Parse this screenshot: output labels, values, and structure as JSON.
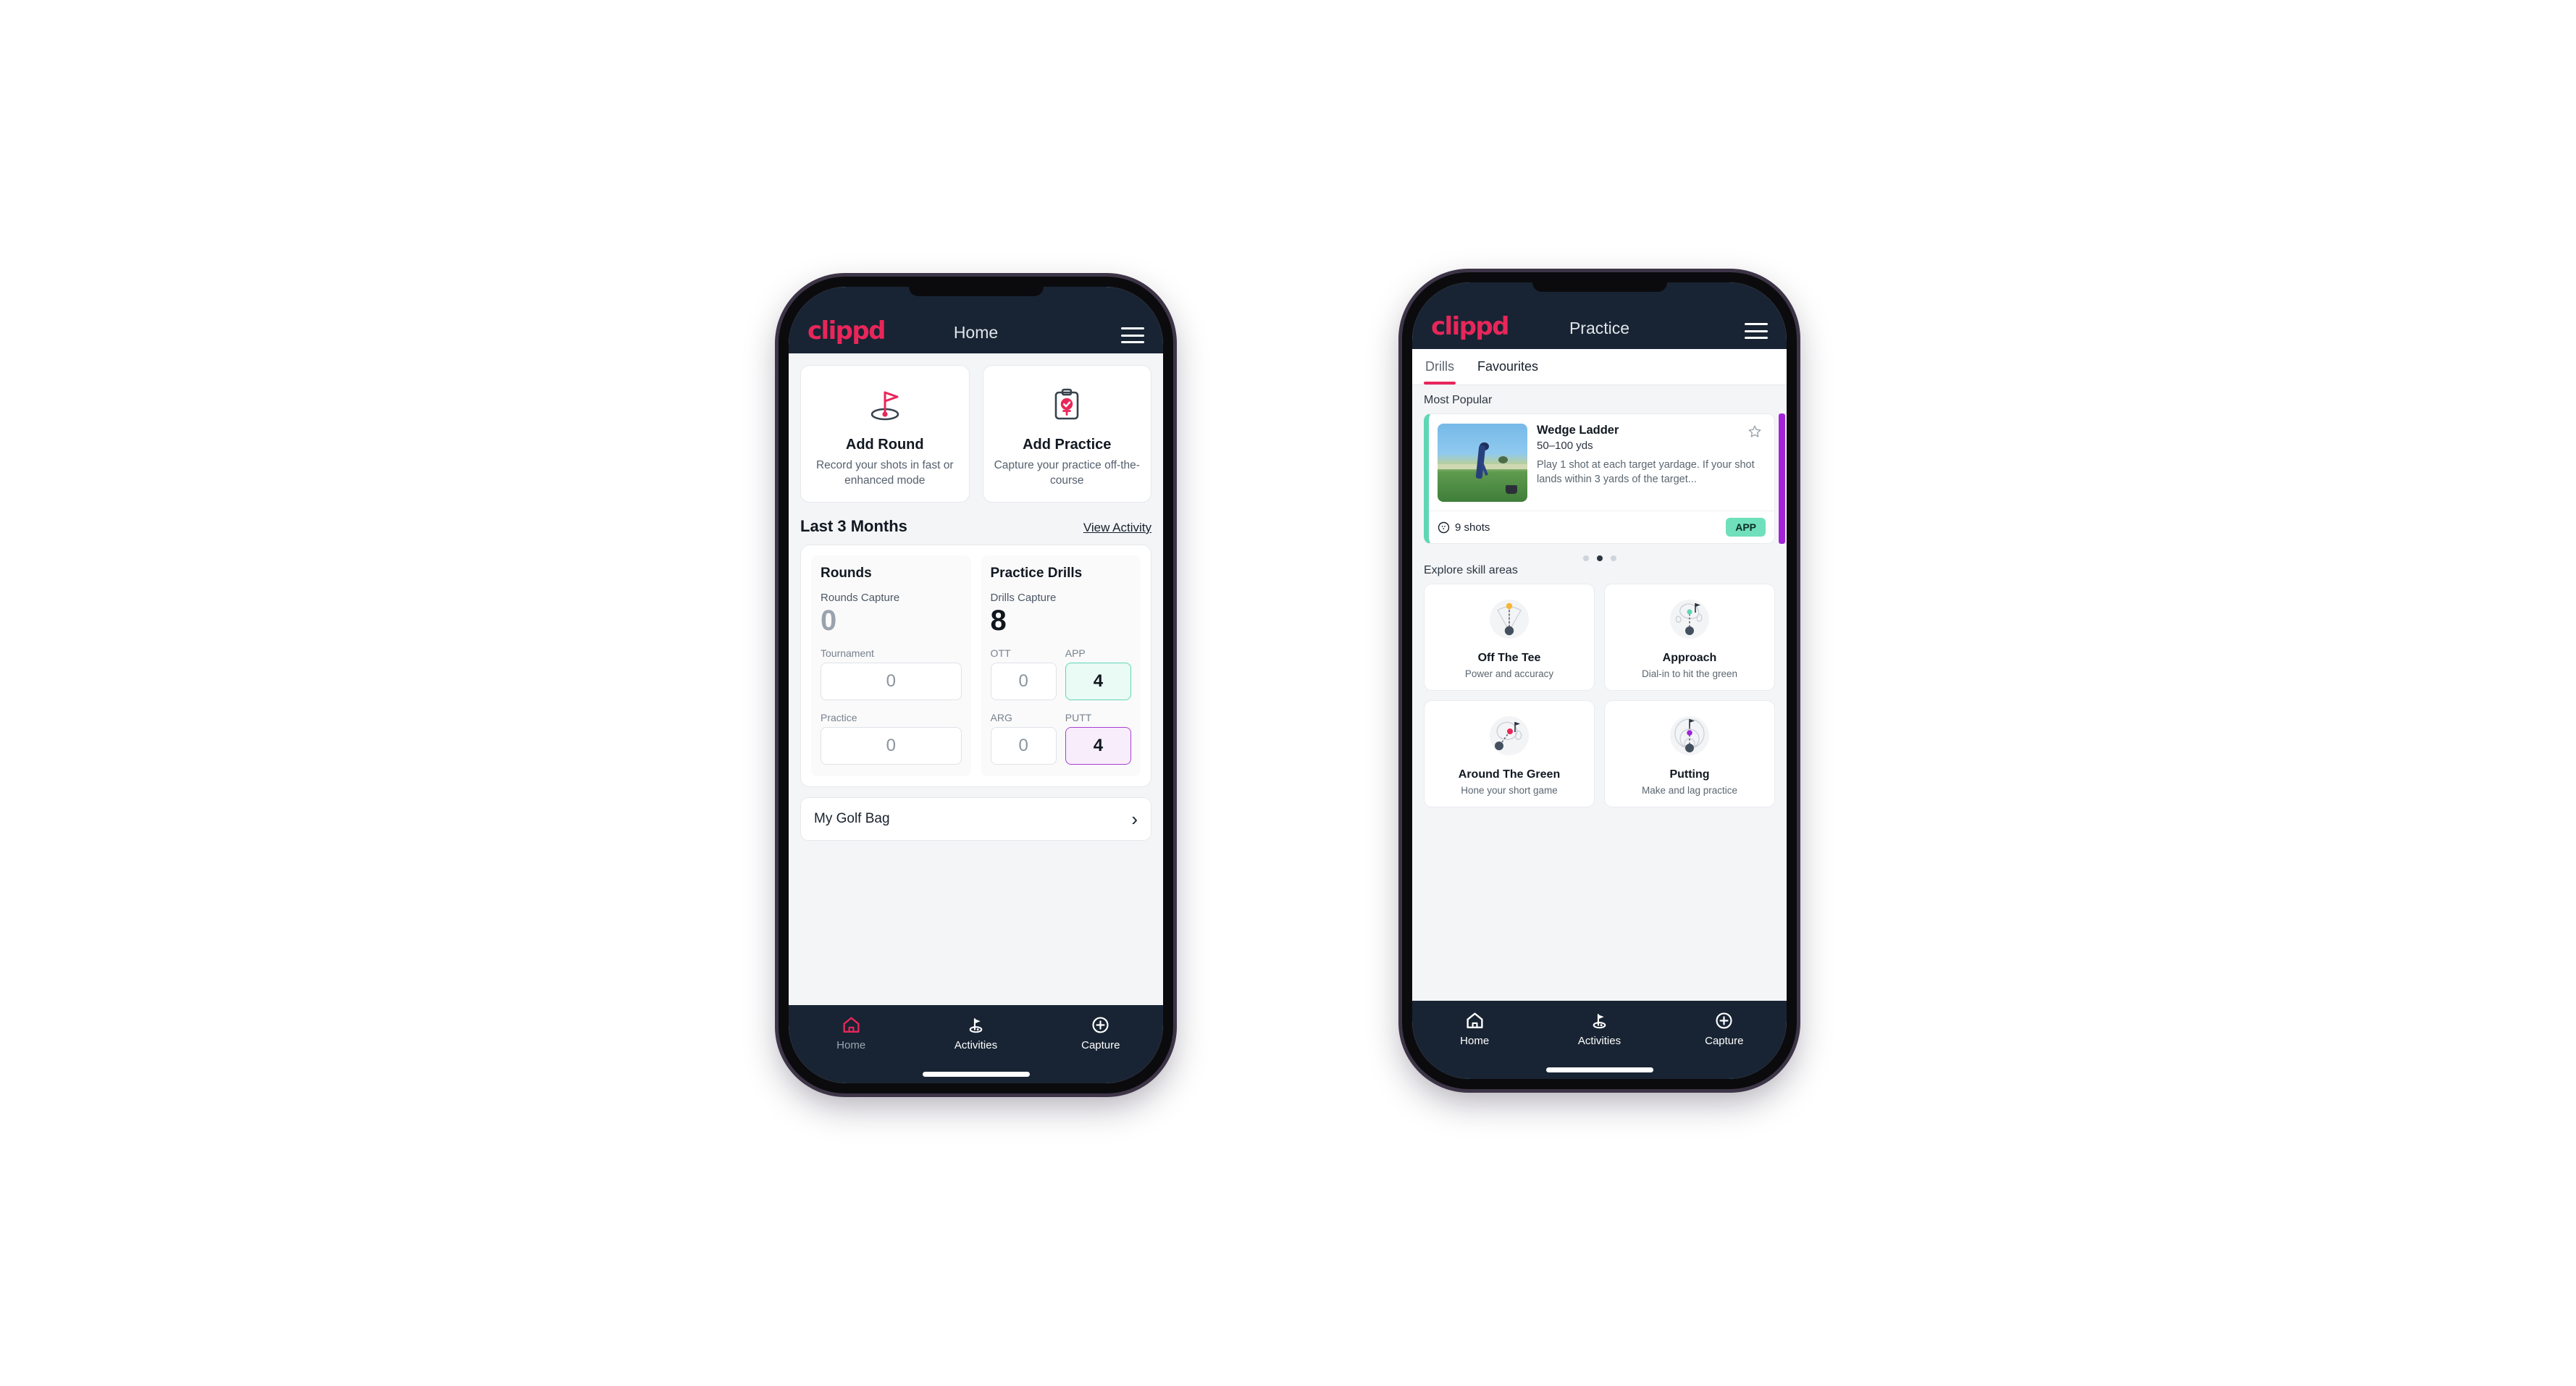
{
  "brand": {
    "logo_text": "clippd",
    "accent_pink": "#e8265a",
    "dark_navy": "#182433",
    "teal": "#6fe0bb",
    "purple": "#a324d8"
  },
  "phone_home": {
    "header": {
      "title": "Home",
      "logo": "clippd",
      "menu_icon": "hamburger-menu-icon"
    },
    "actions": [
      {
        "icon": "golf-flag-hole-icon",
        "title": "Add Round",
        "subtitle": "Record your shots in fast or enhanced mode"
      },
      {
        "icon": "clipboard-check-icon",
        "title": "Add Practice",
        "subtitle": "Capture your practice off-the-course"
      }
    ],
    "section": {
      "title": "Last 3 Months",
      "link": "View Activity"
    },
    "rounds": {
      "title": "Rounds",
      "capture_label": "Rounds Capture",
      "capture_value": "0",
      "fields": [
        {
          "label": "Tournament",
          "value": "0",
          "accent": "none"
        },
        {
          "label": "Practice",
          "value": "0",
          "accent": "none"
        }
      ]
    },
    "drills": {
      "title": "Practice Drills",
      "capture_label": "Drills Capture",
      "capture_value": "8",
      "fields": [
        {
          "label": "OTT",
          "value": "0",
          "accent": "none"
        },
        {
          "label": "APP",
          "value": "4",
          "accent": "teal"
        },
        {
          "label": "ARG",
          "value": "0",
          "accent": "none"
        },
        {
          "label": "PUTT",
          "value": "4",
          "accent": "purple"
        }
      ]
    },
    "golf_bag": {
      "label": "My Golf Bag",
      "chevron": "chevron-right-icon"
    },
    "nav": [
      {
        "icon": "home-icon",
        "label": "Home",
        "active": true
      },
      {
        "icon": "golf-flag-icon",
        "label": "Activities",
        "active": false
      },
      {
        "icon": "plus-circle-icon",
        "label": "Capture",
        "active": false
      }
    ]
  },
  "phone_practice": {
    "header": {
      "title": "Practice",
      "logo": "clippd",
      "menu_icon": "hamburger-menu-icon"
    },
    "tabs": [
      {
        "label": "Drills",
        "active": true
      },
      {
        "label": "Favourites",
        "active": false
      }
    ],
    "most_popular_label": "Most Popular",
    "drill_card": {
      "title": "Wedge Ladder",
      "yardage": "50–100 yds",
      "description": "Play 1 shot at each target yardage. If your shot lands within 3 yards of the target...",
      "shots": "9 shots",
      "shots_icon": "golf-ball-icon",
      "badge": "APP",
      "favourite_icon": "star-outline-icon",
      "accent_left": "#5fd6b4",
      "peek_accent": "#a324d8",
      "thumbnail_alt": "golfer-hitting-wedge-photo"
    },
    "carousel_dots": {
      "count": 3,
      "active_index": 1
    },
    "explore_label": "Explore skill areas",
    "skills": [
      {
        "icon": "off-the-tee-icon",
        "name": "Off The Tee",
        "desc": "Power and accuracy",
        "dot_color": "#f5b731"
      },
      {
        "icon": "approach-icon",
        "name": "Approach",
        "desc": "Dial-in to hit the green",
        "dot_color": "#5fd6b4"
      },
      {
        "icon": "around-the-green-icon",
        "name": "Around The Green",
        "desc": "Hone your short game",
        "dot_color": "#e8265a"
      },
      {
        "icon": "putting-icon",
        "name": "Putting",
        "desc": "Make and lag practice",
        "dot_color": "#9b26d6"
      }
    ],
    "nav": [
      {
        "icon": "home-icon",
        "label": "Home",
        "active": false
      },
      {
        "icon": "golf-flag-icon",
        "label": "Activities",
        "active": true
      },
      {
        "icon": "plus-circle-icon",
        "label": "Capture",
        "active": false
      }
    ]
  }
}
